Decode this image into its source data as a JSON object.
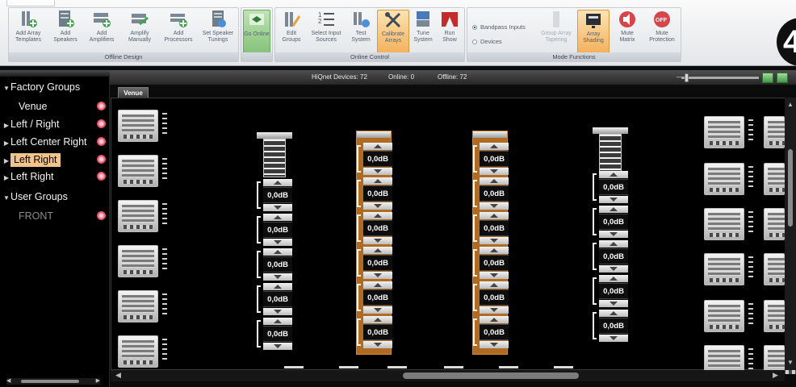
{
  "ribbon": {
    "groups": [
      {
        "label": "Offline Design",
        "buttons": [
          {
            "label": "Add Array Templates",
            "icon": "array-template-icon"
          },
          {
            "label": "Add Speakers",
            "icon": "speaker-icon"
          },
          {
            "label": "Add Amplifiers",
            "icon": "amplifier-icon"
          },
          {
            "label": "Amplify Manually",
            "icon": "amplify-icon"
          },
          {
            "label": "Add Processors",
            "icon": "processor-icon"
          },
          {
            "label": "Set Speaker Tunings",
            "icon": "tuning-icon"
          }
        ]
      },
      {
        "label": "",
        "buttons": [
          {
            "label": "Go Online",
            "icon": "go-online-icon"
          }
        ]
      },
      {
        "label": "Online Control",
        "buttons": [
          {
            "label": "Edit Groups",
            "icon": "edit-groups-icon"
          },
          {
            "label": "Select Input Sources",
            "icon": "input-sources-icon"
          },
          {
            "label": "Test System",
            "icon": "test-icon"
          },
          {
            "label": "Calibrate Arrays",
            "icon": "calibrate-icon"
          },
          {
            "label": "Tune System",
            "icon": "tune-icon"
          },
          {
            "label": "Run Show",
            "icon": "run-show-icon"
          }
        ]
      },
      {
        "label": "Mode Functions",
        "radios": [
          "Bandpass Inputs",
          "Devices"
        ],
        "buttons": [
          {
            "label": "Group Array Tapering",
            "icon": "tapering-icon"
          },
          {
            "label": "Array Shading",
            "icon": "shading-icon"
          },
          {
            "label": "Mute Matrix",
            "icon": "mute-matrix-icon"
          },
          {
            "label": "Mute Protection",
            "icon": "mute-protection-icon"
          }
        ]
      }
    ]
  },
  "badge": "4",
  "status": {
    "devices": "HiQnet Devices: 72",
    "online": "Online: 0",
    "offline": "Offline: 72"
  },
  "tree": {
    "items": [
      {
        "label": "Factory Groups",
        "kind": "header"
      },
      {
        "label": "Venue",
        "kind": "child"
      },
      {
        "label": "Left / Right",
        "kind": "child"
      },
      {
        "label": "Left Center Right",
        "kind": "child"
      },
      {
        "label": "Left Right",
        "kind": "selected"
      },
      {
        "label": "Left Right",
        "kind": "child"
      },
      {
        "label": "User Groups",
        "kind": "header"
      },
      {
        "label": "FRONT",
        "kind": "dim"
      }
    ]
  },
  "venue_tab": "Venue",
  "gain_value": "0,0dB",
  "colors": {
    "accent": "#f3c48a",
    "array_frame": "#b06a22",
    "pin": "#e24b63"
  }
}
